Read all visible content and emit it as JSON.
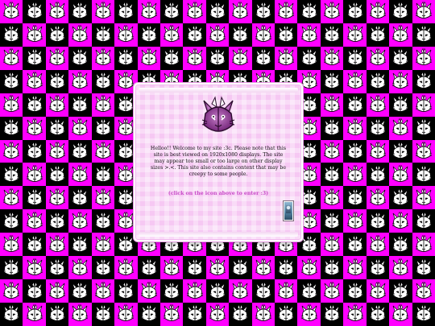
{
  "welcome": {
    "message": "Helloo!! Welcome to my site :3c. Please note that this site is best viewed on 1920x1080 displays. The site may appear too small or too large on other display sizes >.<. This site also contains content that may be creepy to some people.",
    "enter_hint": "(click on the icon above to enter :3)"
  },
  "icons": {
    "background_tile": "cat-mascot-icon",
    "enter_icon": "cat-mascot-enter-icon",
    "thumbnail": "image-thumbnail-icon"
  },
  "colors": {
    "magenta": "#ff00ff",
    "black": "#000000",
    "dialog_pink": "#f6c8f3",
    "hint_text": "#c84ec8",
    "mascot_purple": "#8a2f8f"
  }
}
